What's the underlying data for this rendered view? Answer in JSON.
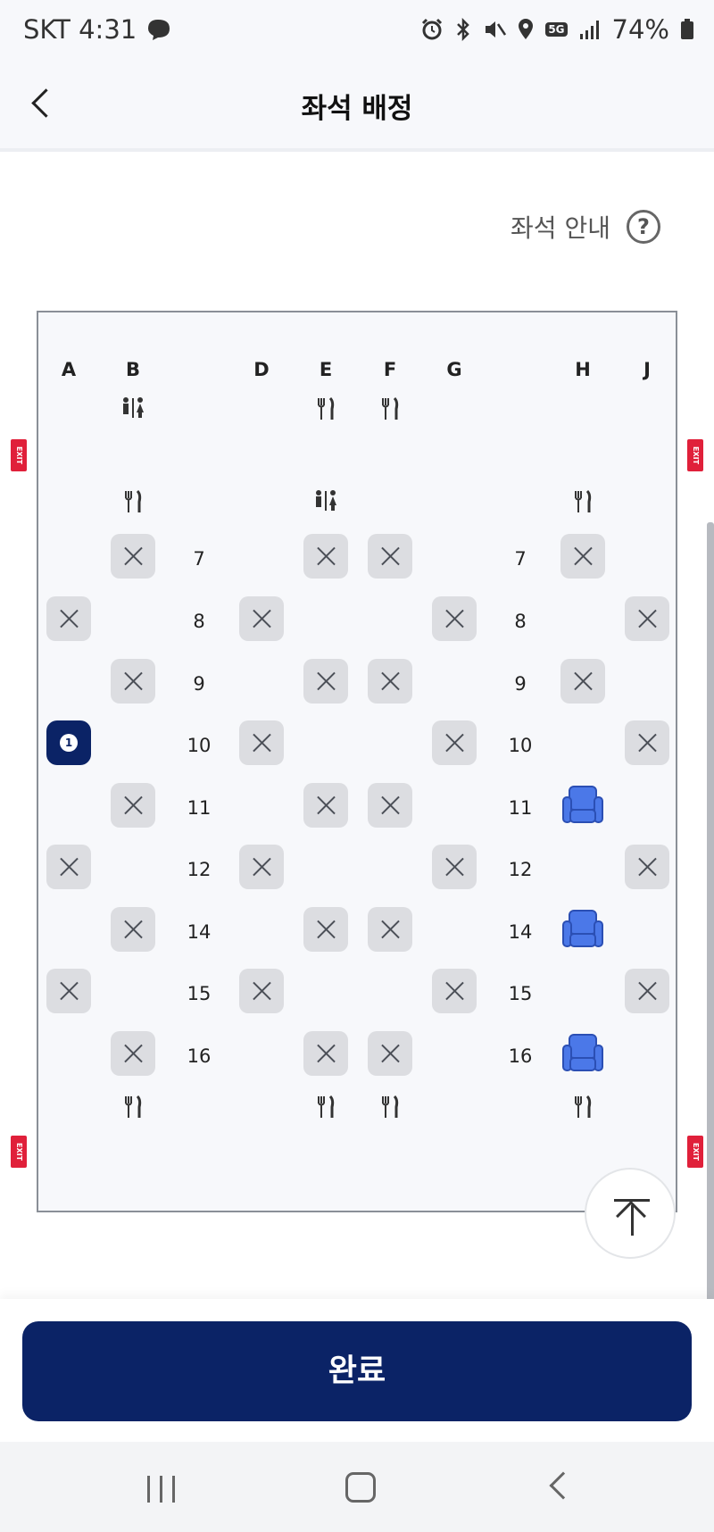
{
  "status_bar": {
    "carrier_time": "SKT 4:31",
    "network": "5G",
    "battery": "74%"
  },
  "header": {
    "title": "좌석 배정"
  },
  "guide": {
    "label": "좌석 안내",
    "help": "?"
  },
  "cabin": {
    "columns": [
      "A",
      "B",
      "D",
      "E",
      "F",
      "G",
      "H",
      "J"
    ],
    "rows": [
      "7",
      "8",
      "9",
      "10",
      "11",
      "12",
      "14",
      "15",
      "16"
    ],
    "exit_label": "EXIT",
    "selected_badge": "1"
  },
  "actions": {
    "done_label": "완료"
  },
  "colors": {
    "primary": "#0b2366",
    "available_seat": "#4b78e8",
    "unavailable_seat": "#dcdde1",
    "exit": "#e0203a"
  },
  "icons": {
    "restroom": "restroom-icon",
    "galley": "fork-knife-icon",
    "back": "chevron-left-icon",
    "help": "question-circle-icon",
    "scroll_top": "arrow-up-to-top-icon"
  }
}
